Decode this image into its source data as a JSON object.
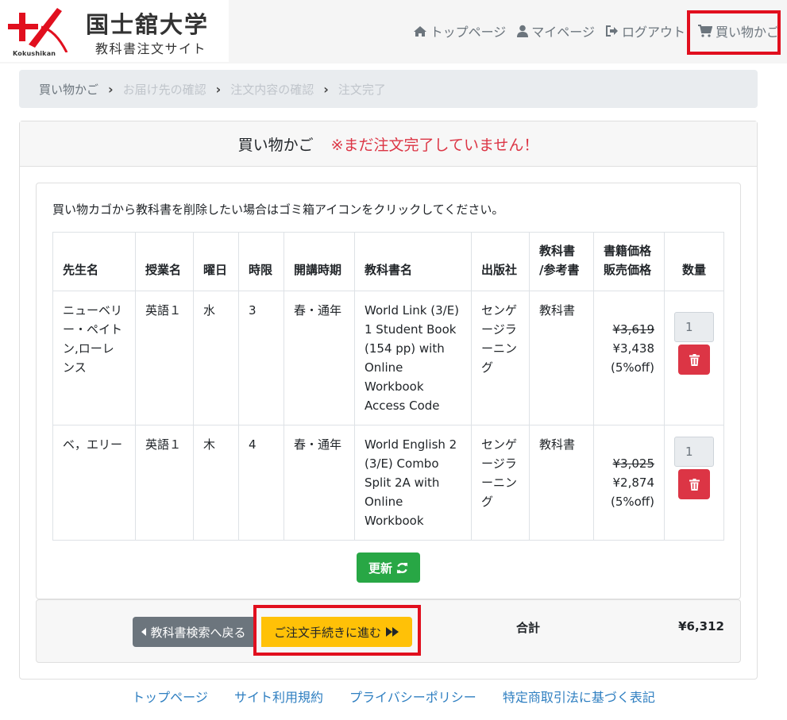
{
  "brand": {
    "university": "国士舘大学",
    "site_name": "教科書注文サイト",
    "logo_text": "Kokushikan",
    "accent_red": "#e10f1e"
  },
  "nav": {
    "items": [
      {
        "label": "トップページ",
        "icon": "home-icon"
      },
      {
        "label": "マイページ",
        "icon": "user-icon"
      },
      {
        "label": "ログアウト",
        "icon": "sign-out-icon"
      },
      {
        "label": "買い物かご",
        "icon": "shopping-cart-icon"
      }
    ]
  },
  "breadcrumb": {
    "items": [
      "買い物かご",
      "お届け先の確認",
      "注文内容の確認",
      "注文完了"
    ]
  },
  "card": {
    "title": "買い物かご",
    "warning": "※まだ注文完了していません！",
    "note": "買い物カゴから教科書を削除したい場合はゴミ箱アイコンをクリックしてください。"
  },
  "table": {
    "headers": {
      "teacher": "先生名",
      "course": "授業名",
      "day": "曜日",
      "period": "時限",
      "term": "開講時期",
      "book": "教科書名",
      "publisher": "出版社",
      "type_line1": "教科書",
      "type_line2": "/参考書",
      "price_line1": "書籍価格",
      "price_line2": "販売価格",
      "qty": "数量"
    },
    "rows": [
      {
        "teacher": "ニューベリー・ペイトン,ローレンス",
        "course": "英語１",
        "day": "水",
        "period": "3",
        "term": "春・通年",
        "book": "World Link (3/E) 1 Student Book (154 pp) with Online Workbook Access Code",
        "publisher": "センゲージラーニング",
        "type": "教科書",
        "list_price": "¥3,619",
        "sale_price": "¥3,438",
        "discount": "(5%off)",
        "qty": "1"
      },
      {
        "teacher": "ベ，エリー",
        "course": "英語１",
        "day": "木",
        "period": "4",
        "term": "春・通年",
        "book": "World English 2 (3/E) Combo Split 2A with Online Workbook",
        "publisher": "センゲージラーニング",
        "type": "教科書",
        "list_price": "¥3,025",
        "sale_price": "¥2,874",
        "discount": "(5%off)",
        "qty": "1"
      }
    ]
  },
  "buttons": {
    "update": "更新",
    "back": "教科書検索へ戻る",
    "proceed": "ご注文手続きに進む"
  },
  "total": {
    "label": "合計",
    "value": "¥6,312"
  },
  "footer": {
    "links": [
      "トップページ",
      "サイト利用規約",
      "プライバシーポリシー",
      "特定商取引法に基づく表記"
    ]
  }
}
